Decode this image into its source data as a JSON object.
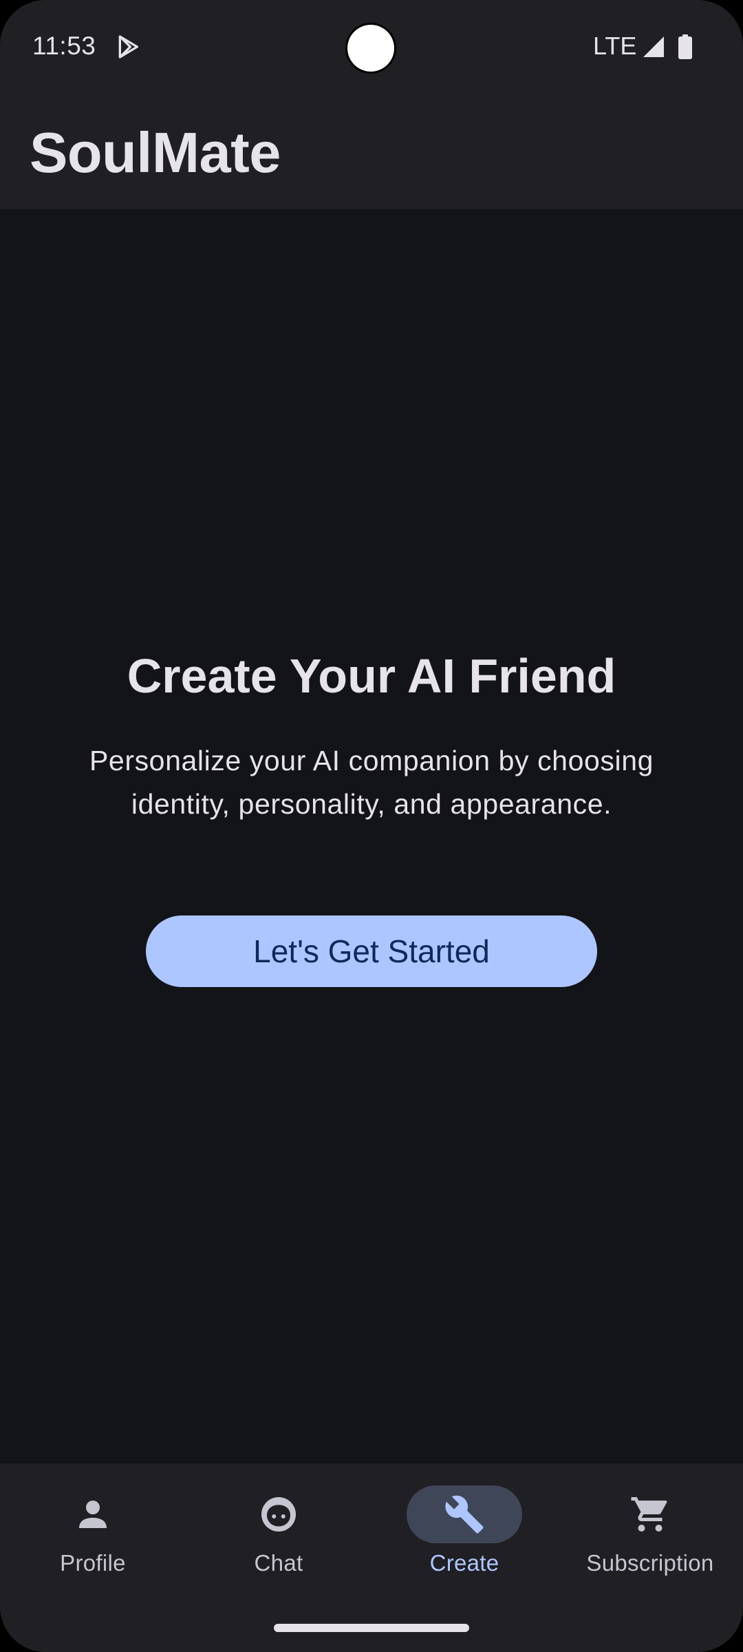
{
  "status_bar": {
    "time": "11:53",
    "network": "LTE",
    "icons": [
      "play-store-icon",
      "signal-icon",
      "battery-icon"
    ]
  },
  "app_bar": {
    "title": "SoulMate"
  },
  "hero": {
    "title": "Create Your AI Friend",
    "description": "Personalize your AI companion by choosing identity, personality, and appearance.",
    "cta_label": "Let's Get Started"
  },
  "bottom_nav": {
    "items": [
      {
        "label": "Profile",
        "icon": "person-icon",
        "active": false
      },
      {
        "label": "Chat",
        "icon": "face-icon",
        "active": false
      },
      {
        "label": "Create",
        "icon": "wrench-icon",
        "active": true
      },
      {
        "label": "Subscription",
        "icon": "cart-icon",
        "active": false
      }
    ]
  },
  "colors": {
    "background": "#131418",
    "surface": "#1F1F24",
    "on_surface": "#E6E3EA",
    "primary": "#AEC6FF",
    "on_primary": "#0E2A5C",
    "nav_indicator": "#3F4658"
  }
}
